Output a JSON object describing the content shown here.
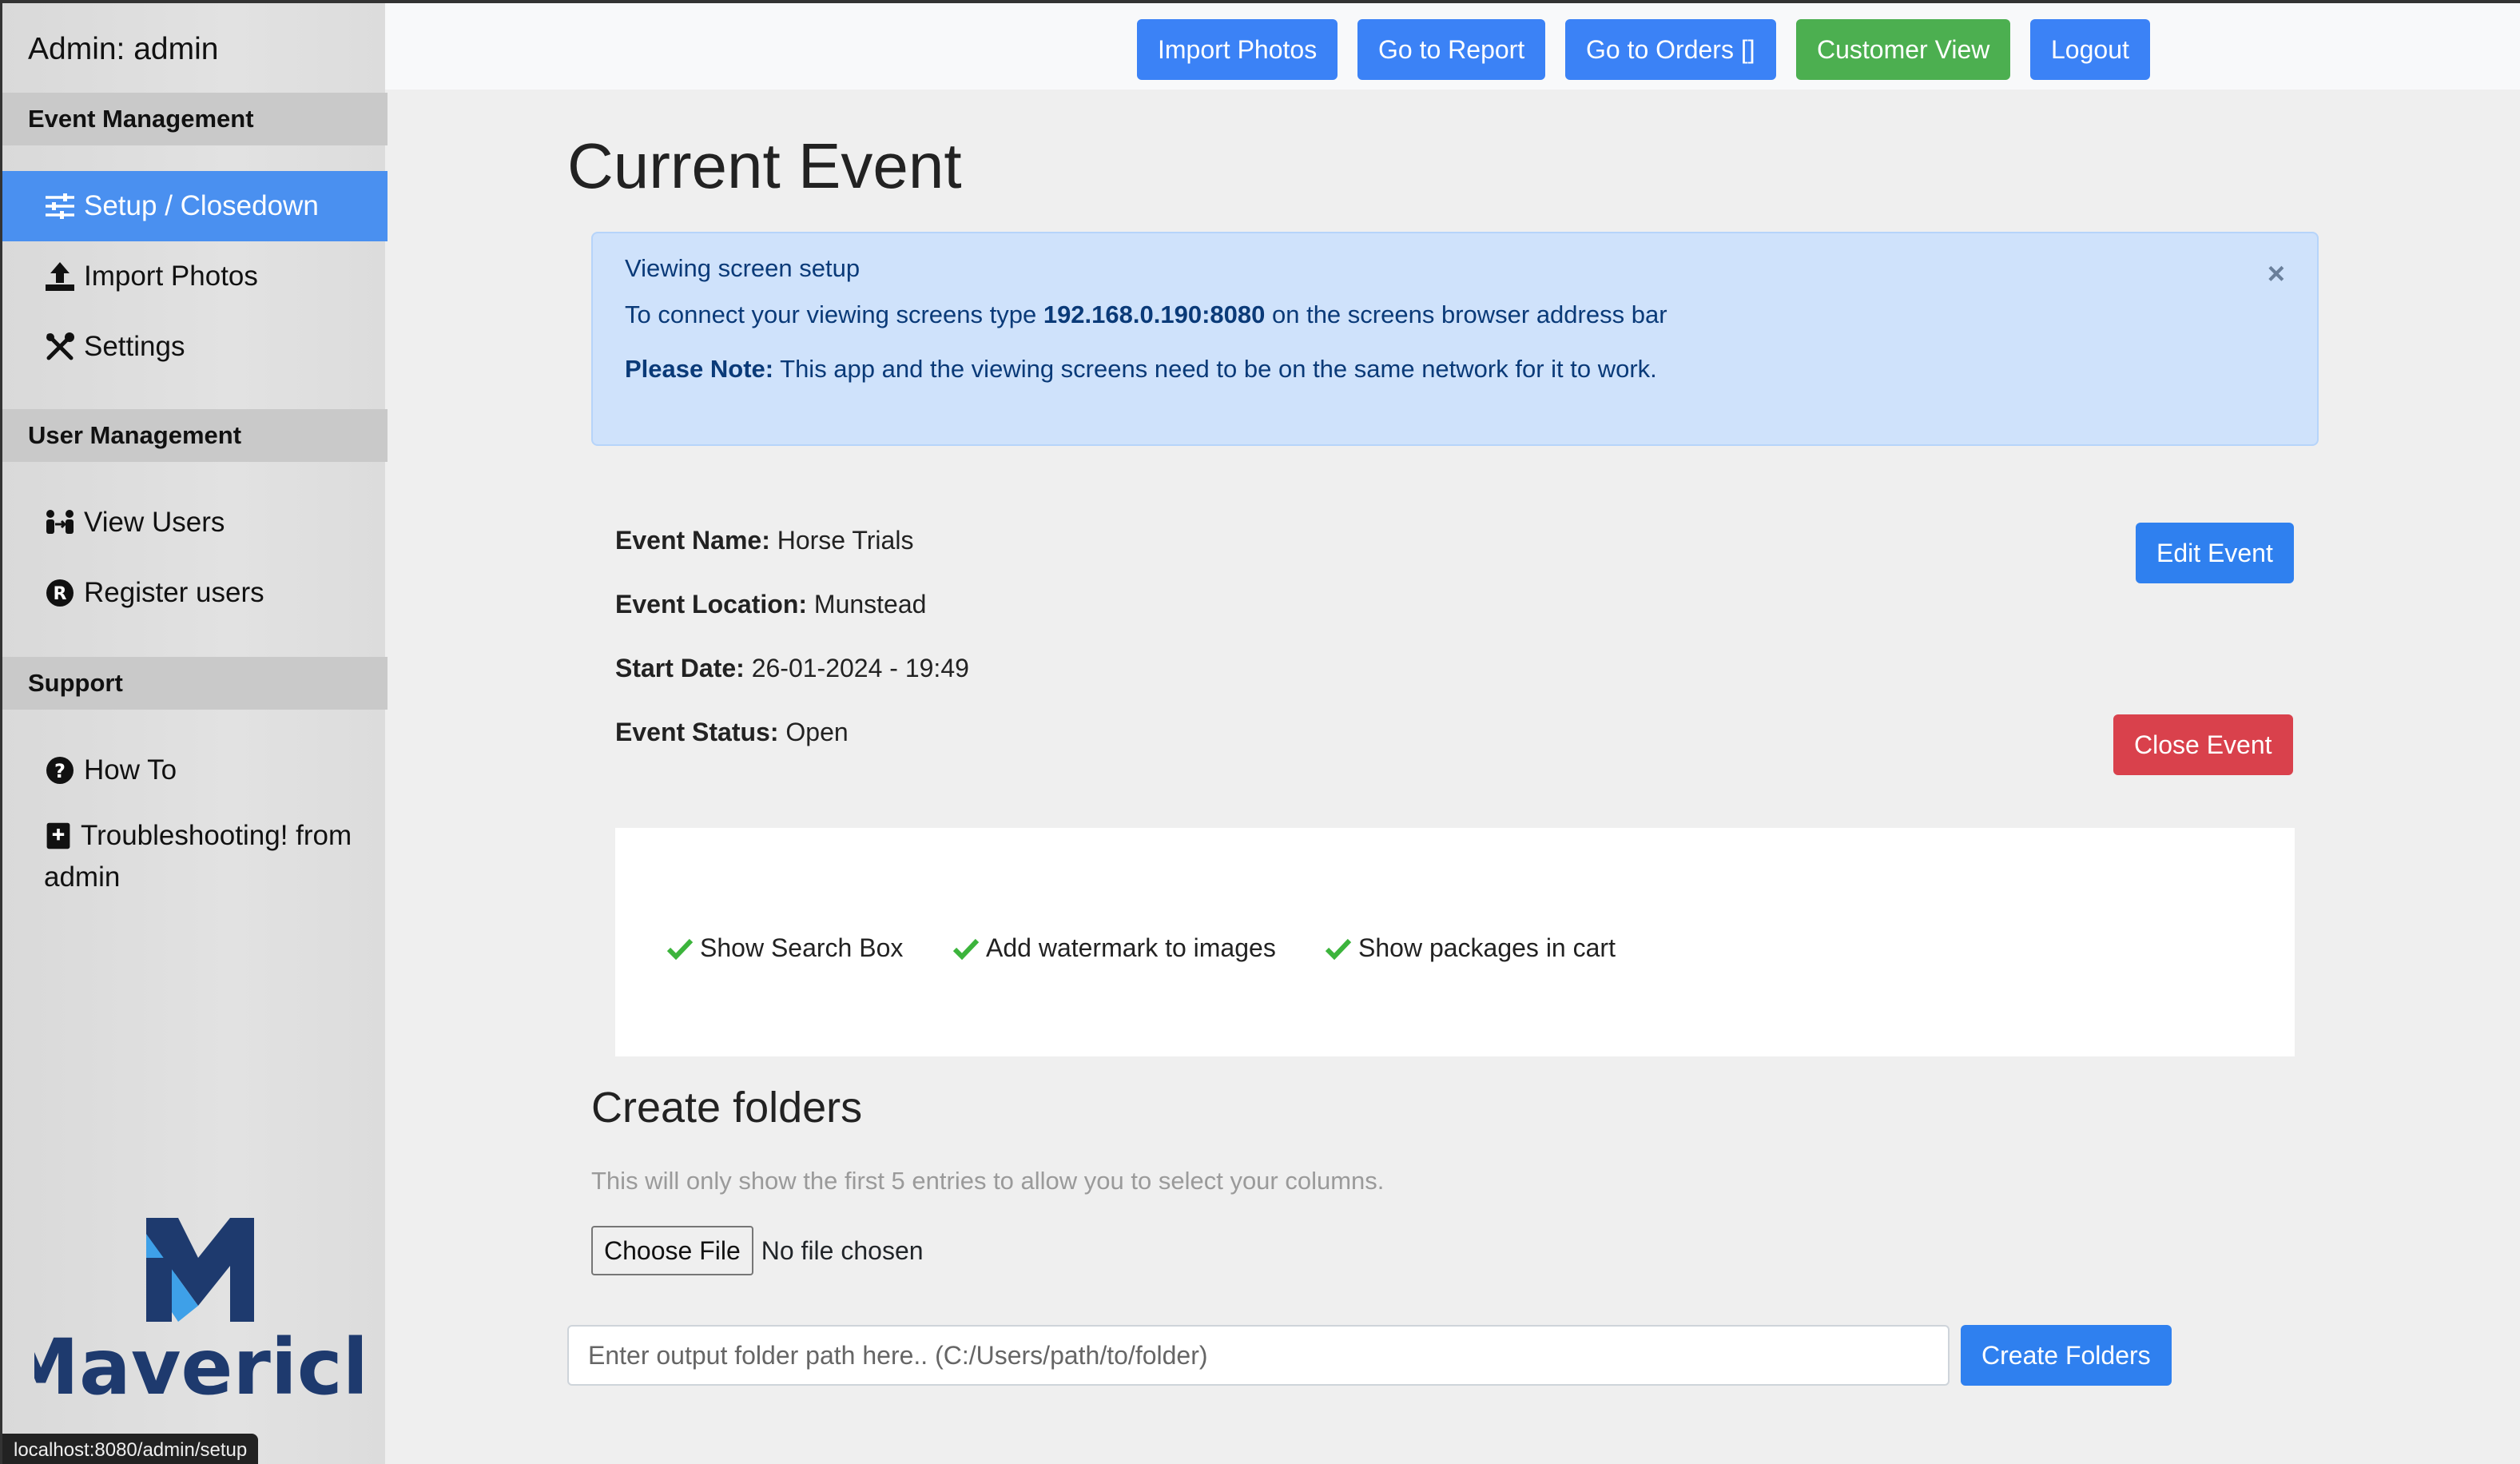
{
  "sidebar": {
    "admin_title": "Admin: admin",
    "sections": {
      "event_management": "Event Management",
      "user_management": "User Management",
      "support": "Support"
    },
    "items": {
      "setup": "Setup / Closedown",
      "import_photos": "Import Photos",
      "settings": "Settings",
      "view_users": "View Users",
      "register_users": "Register users",
      "how_to": "How To",
      "troubleshooting_1": "Troubleshooting! from",
      "troubleshooting_2": "admin"
    },
    "logo_text": "Maverick",
    "status_url": "localhost:8080/admin/setup"
  },
  "topbar": {
    "import_photos": "Import Photos",
    "go_to_report": "Go to Report",
    "go_to_orders": "Go to Orders []",
    "customer_view": "Customer View",
    "logout": "Logout"
  },
  "page": {
    "title": "Current Event"
  },
  "alert": {
    "title": "Viewing screen setup",
    "line_prefix": "To connect your viewing screens type ",
    "address": "192.168.0.190:8080",
    "line_suffix": " on the screens browser address bar",
    "note_label": "Please Note:",
    "note_text": " This app and the viewing screens need to be on the same network for it to work.",
    "close": "×"
  },
  "event": {
    "name_label": "Event Name:",
    "name": " Horse Trials",
    "location_label": "Event Location:",
    "location": " Munstead",
    "start_label": "Start Date:",
    "start": " 26-01-2024 - 19:49",
    "status_label": "Event Status:",
    "status": " Open",
    "edit_button": "Edit Event",
    "close_button": "Close Event"
  },
  "options": {
    "search_box": "Show Search Box",
    "watermark": "Add watermark to images",
    "packages": "Show packages in cart"
  },
  "folders": {
    "title": "Create folders",
    "hint": "This will only show the first 5 entries to allow you to select your columns.",
    "choose_file": "Choose File",
    "no_file": "No file chosen",
    "path_placeholder": "Enter output folder path here.. (C:/Users/path/to/folder)",
    "create_button": "Create Folders"
  },
  "colors": {
    "primary": "#2f80ef",
    "success": "#4caf50",
    "danger": "#d9414c",
    "check": "#3cb43c",
    "logo_dark": "#1e3a6e",
    "logo_light": "#3ea0e8"
  }
}
